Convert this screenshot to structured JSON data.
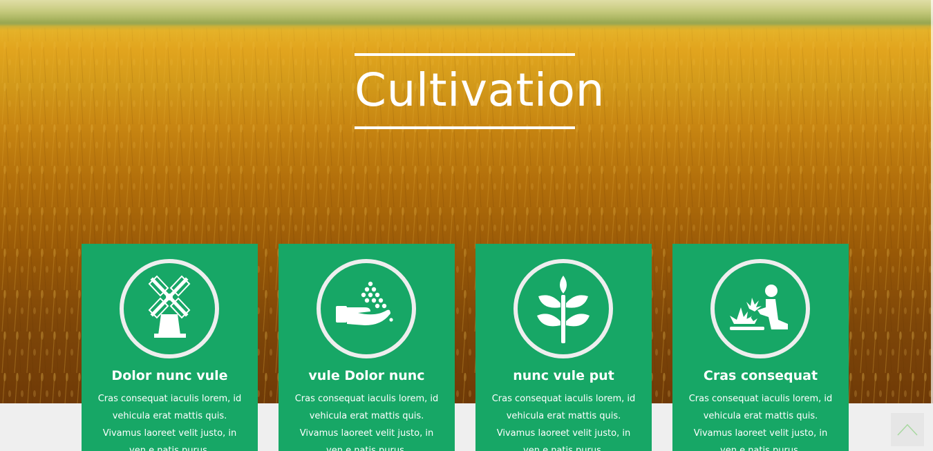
{
  "hero": {
    "title": "Cultivation"
  },
  "colors": {
    "card_green": "#17a766",
    "icon_ring": "#eeeeee",
    "footer_bg": "#efefef",
    "to_top_arrow": "#a8d8a0"
  },
  "cards": [
    {
      "icon": "windmill-icon",
      "title": "Dolor nunc vule",
      "text": "Cras consequat iaculis lorem, id vehicula erat mattis quis. Vivamus laoreet velit justo, in ven e natis purus."
    },
    {
      "icon": "seed-hand-icon",
      "title": "vule Dolor nunc",
      "text": "Cras consequat iaculis lorem, id vehicula erat mattis quis. Vivamus laoreet velit justo, in ven e natis purus."
    },
    {
      "icon": "sprout-icon",
      "title": "nunc vule put",
      "text": "Cras consequat iaculis lorem, id vehicula erat mattis quis. Vivamus laoreet velit justo, in ven e natis purus."
    },
    {
      "icon": "gardener-icon",
      "title": "Cras consequat",
      "text": "Cras consequat iaculis lorem, id vehicula erat mattis quis. Vivamus laoreet velit justo, in ven e natis purus."
    }
  ],
  "scroll_to_top": {
    "icon": "chevron-up-icon"
  }
}
